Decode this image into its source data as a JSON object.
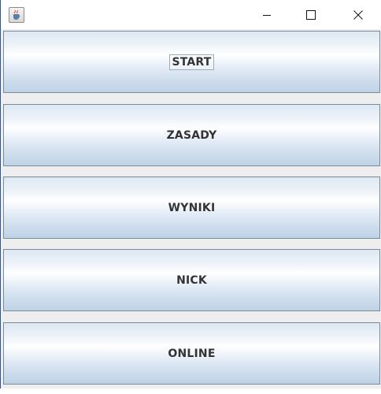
{
  "window": {
    "title": "",
    "icon": "java-cup-icon",
    "controls": {
      "minimize_icon": "minimize-icon",
      "maximize_icon": "maximize-icon",
      "close_icon": "close-icon"
    }
  },
  "menu": {
    "buttons": [
      {
        "label": "START",
        "focused": true
      },
      {
        "label": "ZASADY",
        "focused": false
      },
      {
        "label": "WYNIKI",
        "focused": false
      },
      {
        "label": "NICK",
        "focused": false
      },
      {
        "label": "ONLINE",
        "focused": false
      }
    ]
  },
  "colors": {
    "button_border": "#7a8a99",
    "button_top": "#dde8f3",
    "button_bottom": "#bfd3e6",
    "label_text": "#333333",
    "panel_background": "#eeeeee"
  }
}
